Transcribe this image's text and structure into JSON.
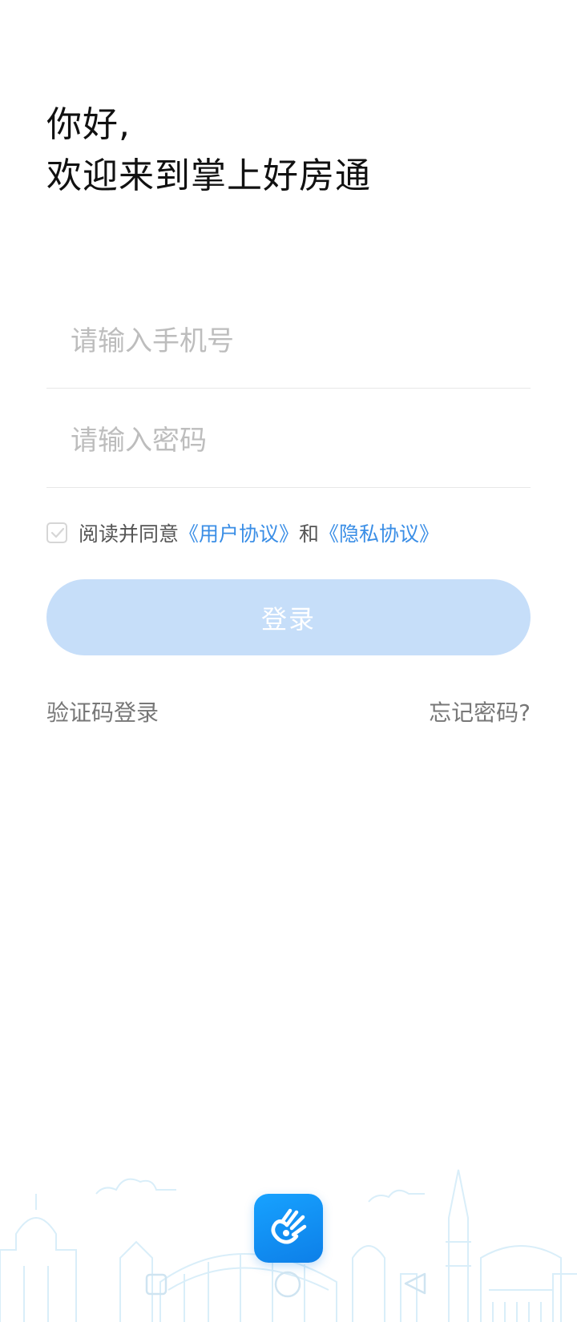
{
  "greeting": {
    "line1": "你好,",
    "line2": "欢迎来到掌上好房通"
  },
  "form": {
    "phone_placeholder": "请输入手机号",
    "password_placeholder": "请输入密码"
  },
  "agreement": {
    "checked": true,
    "prefix": "阅读并同意",
    "user_agreement": "《用户协议》",
    "conjunction": "和",
    "privacy_agreement": "《隐私协议》"
  },
  "login_button": "登录",
  "links": {
    "code_login": "验证码登录",
    "forgot_password": "忘记密码?"
  },
  "colors": {
    "accent": "#3a8ee6",
    "button_disabled": "#c6def9",
    "app_icon": "#1592f5"
  },
  "icons": {
    "checkbox": "check-icon",
    "app": "app-logo-icon",
    "nav_recent": "square-icon",
    "nav_home": "circle-icon",
    "nav_back": "back-triangle-icon"
  }
}
